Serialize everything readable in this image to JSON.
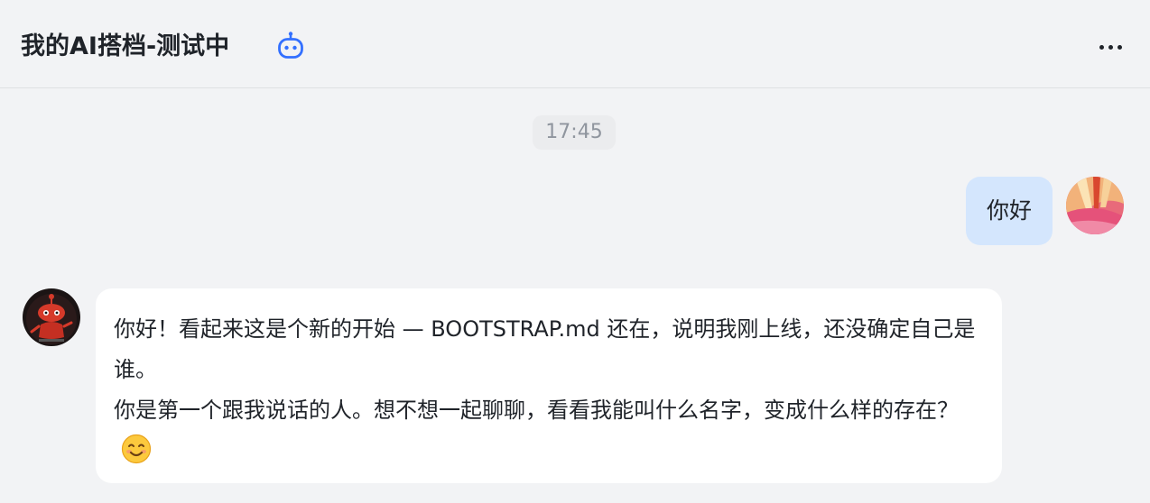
{
  "header": {
    "title": "我的AI搭档-测试中",
    "bot_icon": "robot-icon",
    "more_icon": "more-horizontal-icon"
  },
  "chat": {
    "timestamp": "17:45",
    "messages": [
      {
        "sender": "user",
        "text": "你好",
        "avatar": "user-avatar"
      },
      {
        "sender": "bot",
        "paragraph_1": "你好！看起来这是个新的开始 — BOOTSTRAP.md 还在，说明我刚上线，还没确定自己是谁。",
        "paragraph_2": "你是第一个跟我说话的人。想不想一起聊聊，看看我能叫什么名字，变成什么样的存在？",
        "emoji": "smiling-face-icon",
        "avatar": "bot-avatar"
      }
    ]
  },
  "colors": {
    "background": "#f2f3f5",
    "user_bubble": "#d4e6fd",
    "bot_bubble": "#ffffff",
    "accent": "#3370ff"
  }
}
